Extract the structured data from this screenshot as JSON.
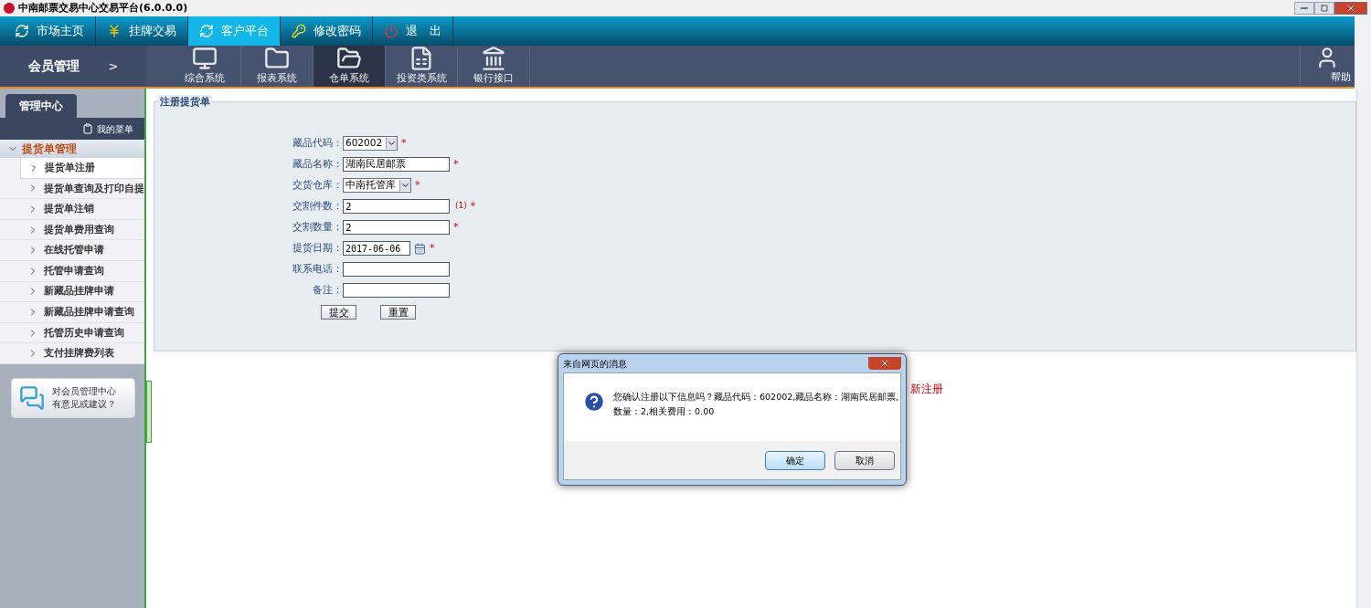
{
  "window": {
    "title": "中南邮票交易中心交易平台(6.0.0.0)"
  },
  "nav": [
    {
      "label": "市场主页",
      "selected": false
    },
    {
      "label": "挂牌交易",
      "selected": false
    },
    {
      "label": "客户平台",
      "selected": true
    },
    {
      "label": "修改密码",
      "selected": false
    },
    {
      "label": "退　出",
      "selected": false
    }
  ],
  "section_title": "会员管理",
  "section_arrow": ">",
  "toolbar": [
    {
      "label": "综合系统",
      "selected": false
    },
    {
      "label": "报表系统",
      "selected": false
    },
    {
      "label": "仓单系统",
      "selected": true
    },
    {
      "label": "投资类系统",
      "selected": false
    },
    {
      "label": "银行接口",
      "selected": false
    }
  ],
  "help": "帮助",
  "sidebar": {
    "tab": "管理中心",
    "my_menu": "我的菜单",
    "group": {
      "label": "提货单管理",
      "expanded": true,
      "items": [
        {
          "label": "提货单注册",
          "selected": true
        },
        {
          "label": "提货单查询及打印自提",
          "selected": false
        },
        {
          "label": "提货单注销",
          "selected": false
        },
        {
          "label": "提货单费用查询",
          "selected": false
        },
        {
          "label": "在线托管申请",
          "selected": false
        },
        {
          "label": "托管申请查询",
          "selected": false
        },
        {
          "label": "新藏品挂牌申请",
          "selected": false
        },
        {
          "label": "新藏品挂牌申请查询",
          "selected": false
        },
        {
          "label": "托管历史申请查询",
          "selected": false
        },
        {
          "label": "支付挂牌费列表",
          "selected": false
        }
      ]
    },
    "feedback": [
      "对会员管理中心",
      "有意见或建议？"
    ]
  },
  "form": {
    "legend": "注册提货单",
    "fields": [
      {
        "label": "藏品代码：",
        "kind": "select",
        "value": "602002",
        "required_mark": "*"
      },
      {
        "label": "藏品名称：",
        "kind": "text",
        "value": "湖南民居邮票",
        "required_mark": "*"
      },
      {
        "label": "交货仓库：",
        "kind": "select",
        "value": "中南托管库",
        "required_mark": "*"
      },
      {
        "label": "交割件数：",
        "kind": "text",
        "value": "2",
        "note": "(1)",
        "required_mark": "*"
      },
      {
        "label": "交割数量：",
        "kind": "text",
        "value": "2",
        "required_mark": "*"
      },
      {
        "label": "提货日期：",
        "kind": "date",
        "value": "2017-06-06",
        "required_mark": "*"
      },
      {
        "label": "联系电话：",
        "kind": "text"
      },
      {
        "label": "备注：",
        "kind": "text"
      }
    ],
    "buttons": [
      "提交",
      "重置"
    ]
  },
  "behind_text": "新注册",
  "dialog": {
    "title": "来自网页的消息",
    "message": "您确认注册以下信息吗？藏品代码：602002,藏品名称：湖南民居邮票,\n数量：2,相关费用：0.00",
    "buttons": [
      {
        "label": "确定",
        "default": true
      },
      {
        "label": "取消",
        "default": false
      }
    ]
  }
}
